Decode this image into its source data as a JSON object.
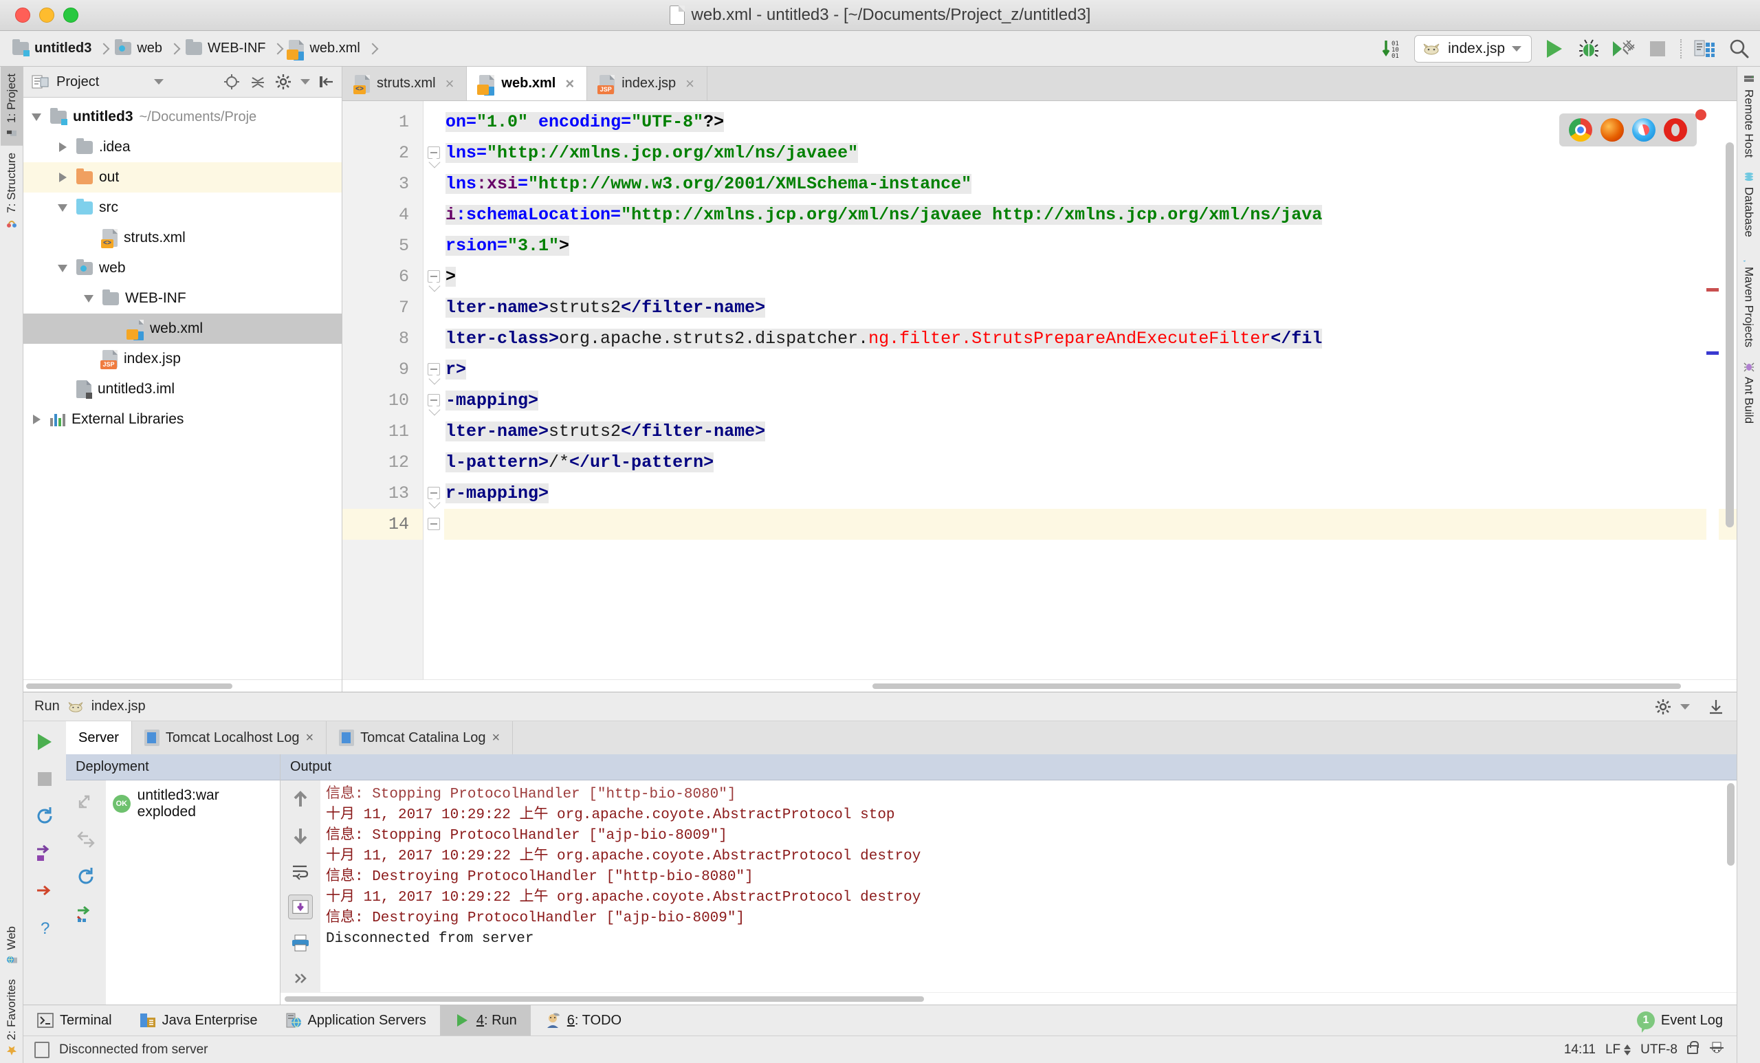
{
  "window": {
    "title": "web.xml - untitled3 - [~/Documents/Project_z/untitled3]",
    "traffic": {
      "close": "close-window",
      "minimize": "minimize-window",
      "zoom": "zoom-window"
    }
  },
  "breadcrumb": [
    {
      "label": "untitled3",
      "icon": "module-folder-icon"
    },
    {
      "label": "web",
      "icon": "web-folder-icon"
    },
    {
      "label": "WEB-INF",
      "icon": "folder-icon"
    },
    {
      "label": "web.xml",
      "icon": "webxml-file-icon"
    }
  ],
  "toolbar": {
    "update_label": "01 10 01",
    "run_config": "index.jsp",
    "run_label": "Run",
    "debug_label": "Debug",
    "coverage_label": "Run with Coverage",
    "stop_label": "Stop",
    "inspect_label": "Inspect",
    "search_label": "Search Everywhere"
  },
  "left_strip": [
    {
      "label": "1: Project",
      "selected": true
    },
    {
      "label": "7: Structure",
      "selected": false
    },
    {
      "label": "Web",
      "selected": false
    },
    {
      "label": "2: Favorites",
      "selected": false
    }
  ],
  "right_strip": [
    {
      "label": "Remote Host"
    },
    {
      "label": "Database"
    },
    {
      "label": "Maven Projects"
    },
    {
      "label": "Ant Build"
    }
  ],
  "project": {
    "header_title": "Project",
    "tree": [
      {
        "label": "untitled3",
        "path": "~/Documents/Proje",
        "indent": 0,
        "twist": "open",
        "icon": "module-folder-icon",
        "bold": true,
        "state": ""
      },
      {
        "label": ".idea",
        "path": "",
        "indent": 1,
        "twist": "closed",
        "icon": "folder-icon",
        "bold": false,
        "state": ""
      },
      {
        "label": "out",
        "path": "",
        "indent": 1,
        "twist": "closed",
        "icon": "folder-orange-icon",
        "bold": false,
        "state": "yellow"
      },
      {
        "label": "src",
        "path": "",
        "indent": 1,
        "twist": "open",
        "icon": "folder-blue-icon",
        "bold": false,
        "state": ""
      },
      {
        "label": "struts.xml",
        "path": "",
        "indent": 2,
        "twist": "none",
        "icon": "xml-file-icon",
        "bold": false,
        "state": ""
      },
      {
        "label": "web",
        "path": "",
        "indent": 1,
        "twist": "open",
        "icon": "web-folder-icon",
        "bold": false,
        "state": ""
      },
      {
        "label": "WEB-INF",
        "path": "",
        "indent": 2,
        "twist": "open",
        "icon": "folder-icon",
        "bold": false,
        "state": ""
      },
      {
        "label": "web.xml",
        "path": "",
        "indent": 3,
        "twist": "none",
        "icon": "webxml-file-icon",
        "bold": false,
        "state": "selected"
      },
      {
        "label": "index.jsp",
        "path": "",
        "indent": 2,
        "twist": "none",
        "icon": "jsp-file-icon",
        "bold": false,
        "state": ""
      },
      {
        "label": "untitled3.iml",
        "path": "",
        "indent": 1,
        "twist": "none",
        "icon": "iml-file-icon",
        "bold": false,
        "state": ""
      },
      {
        "label": "External Libraries",
        "path": "",
        "indent": 0,
        "twist": "closed",
        "icon": "libraries-icon",
        "bold": false,
        "state": ""
      }
    ]
  },
  "editor": {
    "tabs": [
      {
        "label": "struts.xml",
        "icon": "xml-file-icon",
        "active": false
      },
      {
        "label": "web.xml",
        "icon": "webxml-file-icon",
        "active": true
      },
      {
        "label": "index.jsp",
        "icon": "jsp-file-icon",
        "active": false
      }
    ],
    "browsers": [
      "chrome-icon",
      "firefox-icon",
      "safari-icon",
      "opera-icon"
    ],
    "current_line": 14,
    "lines": [
      {
        "n": 1,
        "fold": "none",
        "parts": [
          {
            "t": "on=",
            "c": "attr"
          },
          {
            "t": "\"1.0\"",
            "c": "str"
          },
          {
            "t": " ",
            "c": "txt"
          },
          {
            "t": "encoding=",
            "c": "attr"
          },
          {
            "t": "\"UTF-8\"",
            "c": "str"
          },
          {
            "t": "?>",
            "c": "punct"
          }
        ]
      },
      {
        "n": 2,
        "fold": "tip",
        "parts": [
          {
            "t": "lns=",
            "c": "attr"
          },
          {
            "t": "\"http://xmlns.jcp.org/xml/ns/javaee\"",
            "c": "str"
          }
        ]
      },
      {
        "n": 3,
        "fold": "none",
        "parts": [
          {
            "t": "lns",
            "c": "attr"
          },
          {
            "t": ":xsi",
            "c": "attr2"
          },
          {
            "t": "=",
            "c": "attr"
          },
          {
            "t": "\"http://www.w3.org/2001/XMLSchema-instance\"",
            "c": "str"
          }
        ]
      },
      {
        "n": 4,
        "fold": "none",
        "parts": [
          {
            "t": "i",
            "c": "attr2"
          },
          {
            "t": ":schemaLocation=",
            "c": "attr"
          },
          {
            "t": "\"http://xmlns.jcp.org/xml/ns/javaee http://xmlns.jcp.org/xml/ns/java",
            "c": "str"
          }
        ]
      },
      {
        "n": 5,
        "fold": "none",
        "parts": [
          {
            "t": "rsion=",
            "c": "attr"
          },
          {
            "t": "\"3.1\"",
            "c": "str"
          },
          {
            "t": ">",
            "c": "punct"
          }
        ]
      },
      {
        "n": 6,
        "fold": "tip",
        "parts": [
          {
            "t": ">",
            "c": "punct"
          }
        ]
      },
      {
        "n": 7,
        "fold": "none",
        "parts": [
          {
            "t": "lter-name>",
            "c": "tag"
          },
          {
            "t": "struts2",
            "c": "txt"
          },
          {
            "t": "</filter-name>",
            "c": "tag"
          }
        ]
      },
      {
        "n": 8,
        "fold": "none",
        "parts": [
          {
            "t": "lter-class>",
            "c": "tag"
          },
          {
            "t": "org.apache.struts2.dispatcher.",
            "c": "txt"
          },
          {
            "t": "ng.filter.StrutsPrepareAndExecuteFilter",
            "c": "red"
          },
          {
            "t": "</fil",
            "c": "tag"
          }
        ]
      },
      {
        "n": 9,
        "fold": "tip",
        "parts": [
          {
            "t": "r>",
            "c": "tag"
          }
        ]
      },
      {
        "n": 10,
        "fold": "tip",
        "parts": [
          {
            "t": "-mapping>",
            "c": "tag"
          }
        ]
      },
      {
        "n": 11,
        "fold": "none",
        "parts": [
          {
            "t": "lter-name>",
            "c": "tag"
          },
          {
            "t": "struts2",
            "c": "txt"
          },
          {
            "t": "</filter-name>",
            "c": "tag"
          }
        ]
      },
      {
        "n": 12,
        "fold": "none",
        "parts": [
          {
            "t": "l-pattern>",
            "c": "tag"
          },
          {
            "t": "/*",
            "c": "txt"
          },
          {
            "t": "</url-pattern>",
            "c": "tag"
          }
        ]
      },
      {
        "n": 13,
        "fold": "tip",
        "parts": [
          {
            "t": "r-mapping>",
            "c": "tag"
          }
        ]
      },
      {
        "n": 14,
        "fold": "plain",
        "parts": [
          {
            "t": "",
            "c": "txt"
          }
        ]
      }
    ]
  },
  "run_panel": {
    "header_title": "Run",
    "header_config": "index.jsp",
    "tabs": [
      {
        "label": "Server",
        "icon": "",
        "active": true,
        "closable": false
      },
      {
        "label": "Tomcat Localhost Log",
        "icon": "log-icon",
        "active": false,
        "closable": true
      },
      {
        "label": "Tomcat Catalina Log",
        "icon": "log-icon",
        "active": false,
        "closable": true
      }
    ],
    "columns": {
      "deployment": "Deployment",
      "output": "Output"
    },
    "deployment_items": [
      {
        "label": "untitled3:war exploded",
        "status": "OK"
      }
    ],
    "console_lines": [
      "信息: Stopping ProtocolHandler [\"http-bio-8080\"]",
      "十月 11, 2017 10:29:22 上午 org.apache.coyote.AbstractProtocol stop",
      "信息: Stopping ProtocolHandler [\"ajp-bio-8009\"]",
      "十月 11, 2017 10:29:22 上午 org.apache.coyote.AbstractProtocol destroy",
      "信息: Destroying ProtocolHandler [\"http-bio-8080\"]",
      "十月 11, 2017 10:29:22 上午 org.apache.coyote.AbstractProtocol destroy",
      "信息: Destroying ProtocolHandler [\"ajp-bio-8009\"]",
      "Disconnected from server"
    ]
  },
  "bottom_tabs": [
    {
      "label": "Terminal",
      "icon": "terminal-icon",
      "active": false
    },
    {
      "label": "Java Enterprise",
      "icon": "java-enterprise-icon",
      "active": false
    },
    {
      "label": "Application Servers",
      "icon": "app-servers-icon",
      "active": false
    },
    {
      "label": "4: Run",
      "icon": "run-icon",
      "active": true
    },
    {
      "label": "6: TODO",
      "icon": "todo-icon",
      "active": false
    }
  ],
  "event_log": {
    "label": "Event Log",
    "count": "1"
  },
  "status_bar": {
    "message": "Disconnected from server",
    "caret": "14:11",
    "line_separator": "LF",
    "encoding": "UTF-8"
  }
}
